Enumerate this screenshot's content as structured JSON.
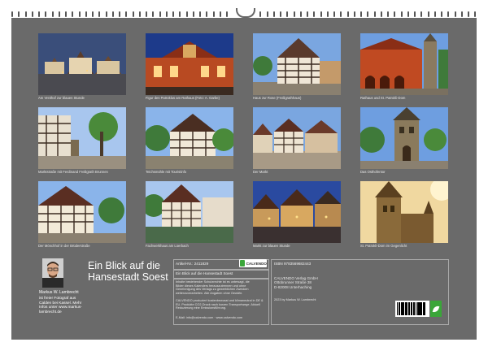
{
  "photos": [
    {
      "caption": "Am Vreithof zur blauen Stunde",
      "scene": "square-dusk"
    },
    {
      "caption": "Figur des Patroklus am Rathaus (Foto: A. Garbe)",
      "scene": "red-building-night"
    },
    {
      "caption": "Haus zur Rose (Freiligrathhaus)",
      "scene": "timber-day"
    },
    {
      "caption": "Rathaus und St. Patrokli-Dom",
      "scene": "red-arcade"
    },
    {
      "caption": "Marktstraße mit Ferdinand Freiligrath Brunnen",
      "scene": "street-fountain"
    },
    {
      "caption": "Teichsmühle mit Touristinfo",
      "scene": "timber-green"
    },
    {
      "caption": "Der Markt",
      "scene": "market-row"
    },
    {
      "caption": "Das Osthofentor",
      "scene": "gate-tower"
    },
    {
      "caption": "Der Mönchhof in der Brüderstraße",
      "scene": "timber-wide"
    },
    {
      "caption": "Fachwerkhaus am Loerbach",
      "scene": "canal-timber"
    },
    {
      "caption": "Markt zur blauen Stunde",
      "scene": "market-night"
    },
    {
      "caption": "St. Patrokli-Dom im Gegenlicht",
      "scene": "cathedral-light"
    }
  ],
  "title_lines": [
    "Ein Blick auf die",
    "Hansestadt Soest"
  ],
  "author": {
    "name": "Markus W. Lambrecht",
    "bio_lines": [
      "ist freier Fotograf aus",
      "Calden bei Kassel. Mehr",
      "Infos unter www.markus-",
      "lambrecht.de"
    ]
  },
  "info": {
    "article": "Artikel-Nr.: 2411829",
    "logo_text": "CALVENDO",
    "isbn": "ISBN 9783569682443",
    "calendar_title": "Ein Blick auf die Hansestadt Soest",
    "publisher_lines": [
      "CALVENDO Verlag GmbH",
      "Ottobrunner Straße 38",
      "D-82008 Unterhaching"
    ],
    "description_lines": [
      "Inhalte bestehender Schutzrechte ist es untersagt, die",
      "Bilder dieses Kalenders herauszutrennen und ohne",
      "Genehmigung des Verlags zu gewerblichen Zwecken",
      "weiterzuverarbeiten. Alle Angaben ohne Gewähr."
    ],
    "production_lines": [
      "CALVENDO produziert kostenbewusst und klimaneutral in DE &",
      "EU. Produkte CO2-Druck nach kurzen Transportwege. Aktuell",
      "Reduzierung eine Emissionsführung."
    ],
    "copyright": "2023 by Markus W. Lambrecht",
    "contact": "E-Mail: info@calvendo.com · www.calvendo.com"
  }
}
